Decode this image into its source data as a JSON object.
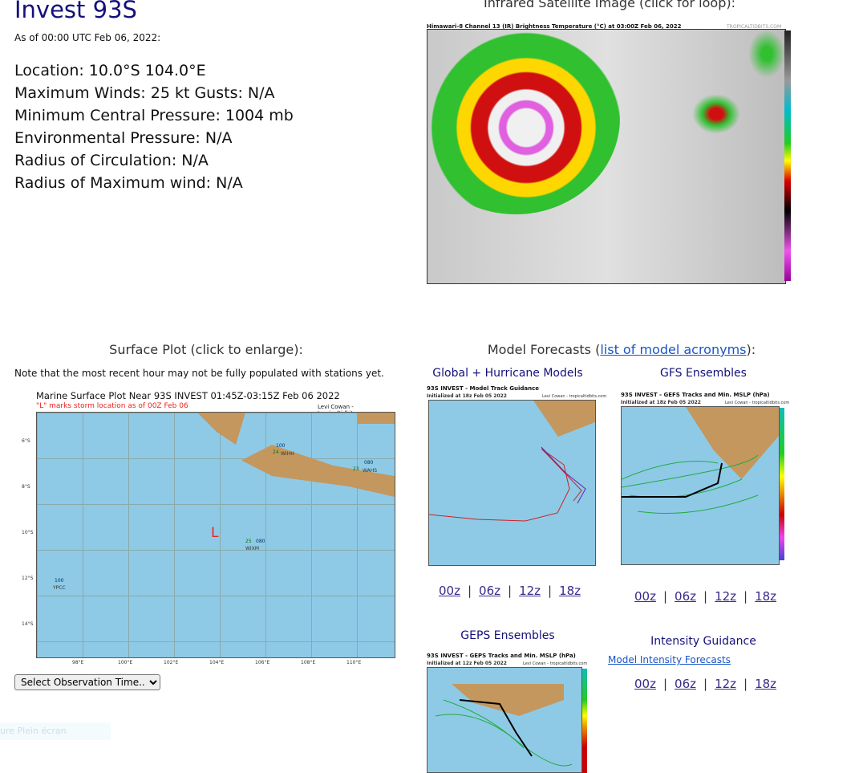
{
  "storm": {
    "title": "Invest 93S",
    "as_of": "As of 00:00 UTC Feb 06, 2022:",
    "lines": [
      "Location: 10.0°S 104.0°E",
      "Maximum Winds: 25 kt  Gusts: N/A",
      "Minimum Central Pressure: 1004 mb",
      "Environmental Pressure: N/A",
      "Radius of Circulation: N/A",
      "Radius of Maximum wind: N/A"
    ]
  },
  "satellite": {
    "heading": "Infrared Satellite Image (click for loop):",
    "image_title": "Himawari-8 Channel 13 (IR) Brightness Temperature (°C) at 03:00Z Feb 06, 2022",
    "credit": "TROPICALTIDBITS.COM"
  },
  "surface": {
    "heading": "Surface Plot (click to enlarge):",
    "note": "Note that the most recent hour may not be fully populated with stations yet.",
    "plot_title": "Marine Surface Plot Near 93S INVEST 01:45Z-03:15Z Feb 06 2022",
    "plot_subtitle": "\"L\" marks storm location as of 00Z Feb 06",
    "credit": "Levi Cowan - tropicaltidbits.com",
    "storm_marker": "L",
    "x_ticks": [
      "98°E",
      "100°E",
      "102°E",
      "104°E",
      "106°E",
      "108°E",
      "110°E"
    ],
    "y_ticks": [
      "6°S",
      "8°S",
      "10°S",
      "12°S",
      "14°S"
    ],
    "stations": [
      {
        "id": "WIHH",
        "t": "24",
        "p": "100"
      },
      {
        "id": "WAHS",
        "t": "23",
        "p": "080"
      },
      {
        "id": "WIXM",
        "t": "25",
        "p": "080"
      },
      {
        "id": "YPCC",
        "t": "",
        "p": "100"
      }
    ],
    "select_label": "Select Observation Time..."
  },
  "models": {
    "heading_prefix": "Model Forecasts (",
    "heading_link": "list of model acronyms",
    "heading_suffix": "):",
    "global": {
      "title": "Global + Hurricane Models",
      "image_title": "93S INVEST - Model Track Guidance",
      "init": "Initialized at 18z Feb 05 2022",
      "credit": "Levi Cowan - tropicaltidbits.com"
    },
    "gefs": {
      "title": "GFS Ensembles",
      "image_title": "93S INVEST - GEFS Tracks and Min. MSLP (hPa)",
      "init": "Initialized at 18z Feb 05 2022",
      "credit": "Levi Cowan - tropicaltidbits.com"
    },
    "geps": {
      "title": "GEPS Ensembles",
      "image_title": "93S INVEST - GEPS Tracks and Min. MSLP (hPa)",
      "init": "Initialized at 12z Feb 05 2022",
      "credit": "Levi Cowan - tropicaltidbits.com"
    },
    "intensity": {
      "title": "Intensity Guidance",
      "link": "Model Intensity Forecasts"
    },
    "runs": [
      "00z",
      "06z",
      "12z",
      "18z"
    ],
    "separator": "|"
  },
  "overlay_text": "ure Plein écran"
}
